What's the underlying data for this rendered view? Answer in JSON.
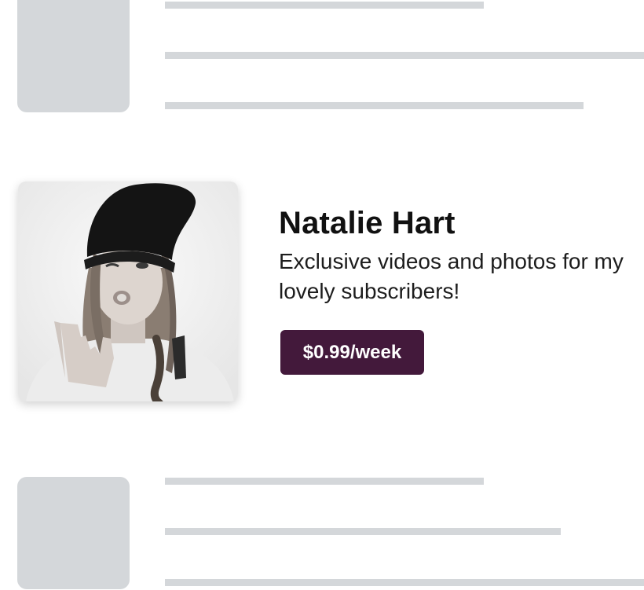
{
  "profile": {
    "name": "Natalie Hart",
    "bio": "Exclusive videos and photos for my lovely subscribers!",
    "price_label": "$0.99/week"
  },
  "colors": {
    "placeholder": "#d4d7da",
    "button": "#43193b"
  }
}
